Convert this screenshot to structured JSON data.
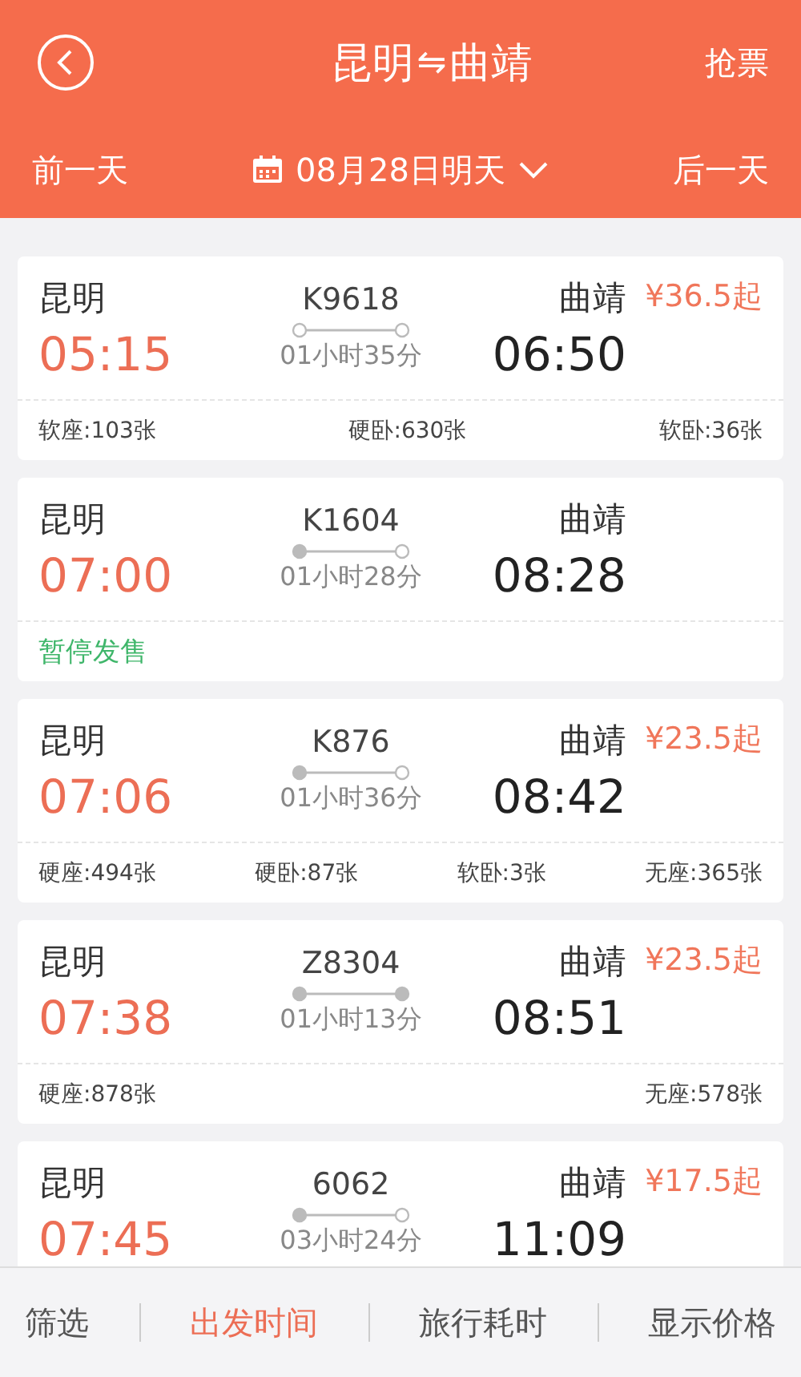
{
  "header": {
    "title_from": "昆明",
    "swap_icon": "⇋",
    "title_to": "曲靖",
    "action": "抢票",
    "prev_day": "前一天",
    "date": "08月28日明天",
    "next_day": "后一天"
  },
  "trains": [
    {
      "from": "昆明",
      "depart": "05:15",
      "number": "K9618",
      "duration": "01小时35分",
      "start_dot_filled": false,
      "end_dot_filled": false,
      "to": "曲靖",
      "arrive": "06:50",
      "price": "¥36.5起",
      "seats": [
        "软座:103张",
        "硬卧:630张",
        "软卧:36张"
      ]
    },
    {
      "from": "昆明",
      "depart": "07:00",
      "number": "K1604",
      "duration": "01小时28分",
      "start_dot_filled": true,
      "end_dot_filled": false,
      "to": "曲靖",
      "arrive": "08:28",
      "status": "暂停发售"
    },
    {
      "from": "昆明",
      "depart": "07:06",
      "number": "K876",
      "duration": "01小时36分",
      "start_dot_filled": true,
      "end_dot_filled": false,
      "to": "曲靖",
      "arrive": "08:42",
      "price": "¥23.5起",
      "seats": [
        "硬座:494张",
        "硬卧:87张",
        "软卧:3张",
        "无座:365张"
      ]
    },
    {
      "from": "昆明",
      "depart": "07:38",
      "number": "Z8304",
      "duration": "01小时13分",
      "start_dot_filled": true,
      "end_dot_filled": true,
      "to": "曲靖",
      "arrive": "08:51",
      "price": "¥23.5起",
      "seats": [
        "硬座:878张",
        "无座:578张"
      ]
    },
    {
      "from": "昆明",
      "depart": "07:45",
      "number": "6062",
      "duration": "03小时24分",
      "start_dot_filled": true,
      "end_dot_filled": false,
      "to": "曲靖",
      "arrive": "11:09",
      "price": "¥17.5起"
    }
  ],
  "bottom_bar": [
    {
      "label": "筛选",
      "selected": false
    },
    {
      "label": "出发时间",
      "selected": true
    },
    {
      "label": "旅行耗时",
      "selected": false
    },
    {
      "label": "显示价格",
      "selected": false
    }
  ]
}
